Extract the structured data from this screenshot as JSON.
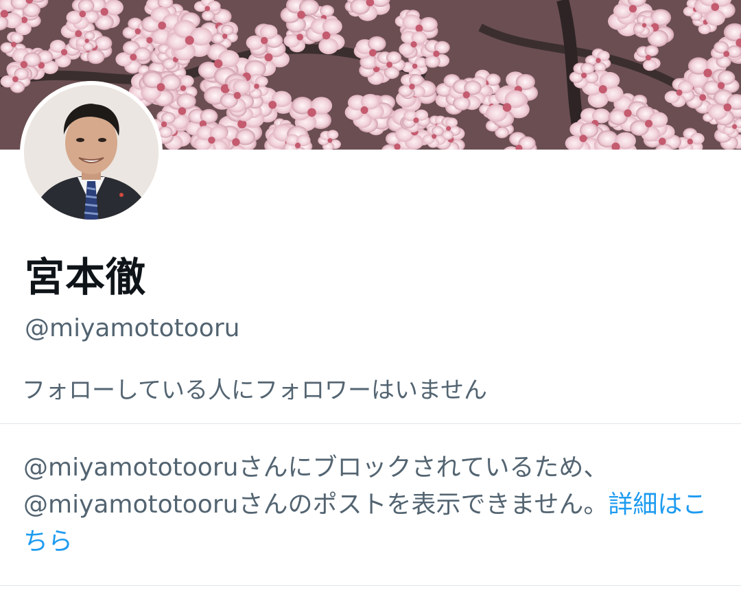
{
  "profile": {
    "display_name": "宮本徹",
    "handle": "@miyamototooru",
    "follow_note": "フォローしている人にフォロワーはいません"
  },
  "blocked_notice": {
    "line1": "@miyamototooruさんにブロックされているため、",
    "line2": "@miyamototooruさんのポストを表示できません。",
    "learn_more_link": "詳細はこちら"
  },
  "colors": {
    "secondary_text": "#536471",
    "primary_text": "#0f1419",
    "link": "#1d9bf0",
    "divider": "#e1e6ea"
  },
  "icons": {
    "banner": "cherry-blossom-banner-image",
    "avatar": "profile-avatar-photo"
  }
}
